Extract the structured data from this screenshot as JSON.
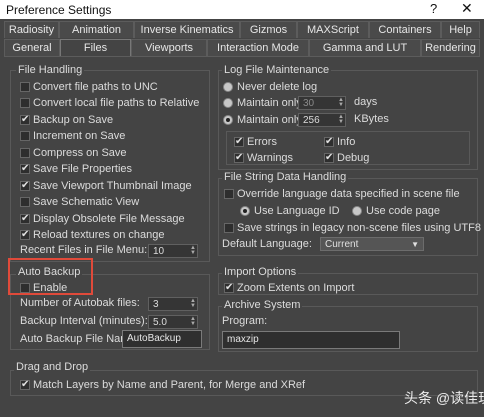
{
  "window": {
    "title": "Preference Settings",
    "help": "?",
    "close": "✕"
  },
  "tabs_row1": [
    "Radiosity",
    "Animation",
    "Inverse Kinematics",
    "Gizmos",
    "MAXScript",
    "Containers",
    "Help"
  ],
  "tabs_row2": [
    "General",
    "Files",
    "Viewports",
    "Interaction Mode",
    "Gamma and LUT",
    "Rendering"
  ],
  "file_handling": {
    "title": "File Handling",
    "items": [
      {
        "label": "Convert file paths to UNC",
        "checked": false
      },
      {
        "label": "Convert local file paths to Relative",
        "checked": false
      },
      {
        "label": "Backup on Save",
        "checked": true
      },
      {
        "label": "Increment on Save",
        "checked": false
      },
      {
        "label": "Compress on Save",
        "checked": false
      },
      {
        "label": "Save File Properties",
        "checked": true
      },
      {
        "label": "Save Viewport Thumbnail Image",
        "checked": true
      },
      {
        "label": "Save Schematic View",
        "checked": false
      },
      {
        "label": "Display Obsolete File Message",
        "checked": true
      },
      {
        "label": "Reload textures on change",
        "checked": true
      }
    ],
    "recent_label": "Recent Files in File Menu:",
    "recent_value": "10"
  },
  "auto_backup": {
    "title": "Auto Backup",
    "enable_label": "Enable",
    "enable_checked": false,
    "num_label": "Number of Autobak files:",
    "num_value": "3",
    "interval_label": "Backup Interval (minutes):",
    "interval_value": "5.0",
    "name_label": "Auto Backup File Name:",
    "name_value": "AutoBackup"
  },
  "log": {
    "title": "Log File Maintenance",
    "never": "Never delete log",
    "maintain1": "Maintain only",
    "days_value": "30",
    "days_unit": "days",
    "maintain2": "Maintain only",
    "kb_value": "256",
    "kb_unit": "KBytes",
    "errors": "Errors",
    "info": "Info",
    "warnings": "Warnings",
    "debug": "Debug"
  },
  "string": {
    "title": "File String Data Handling",
    "override": "Override language data specified in scene file",
    "use_lang": "Use Language ID",
    "use_code": "Use code page",
    "save_strings": "Save strings in legacy non-scene files using UTF8",
    "default_label": "Default Language:",
    "default_value": "Current"
  },
  "import": {
    "title": "Import Options",
    "zoom": "Zoom Extents on Import"
  },
  "archive": {
    "title": "Archive System",
    "program_label": "Program:",
    "program_value": "maxzip"
  },
  "dragdrop": {
    "title": "Drag and Drop",
    "match": "Match Layers by Name and Parent, for Merge and XRef"
  },
  "watermark": "头条 @读佳玩"
}
